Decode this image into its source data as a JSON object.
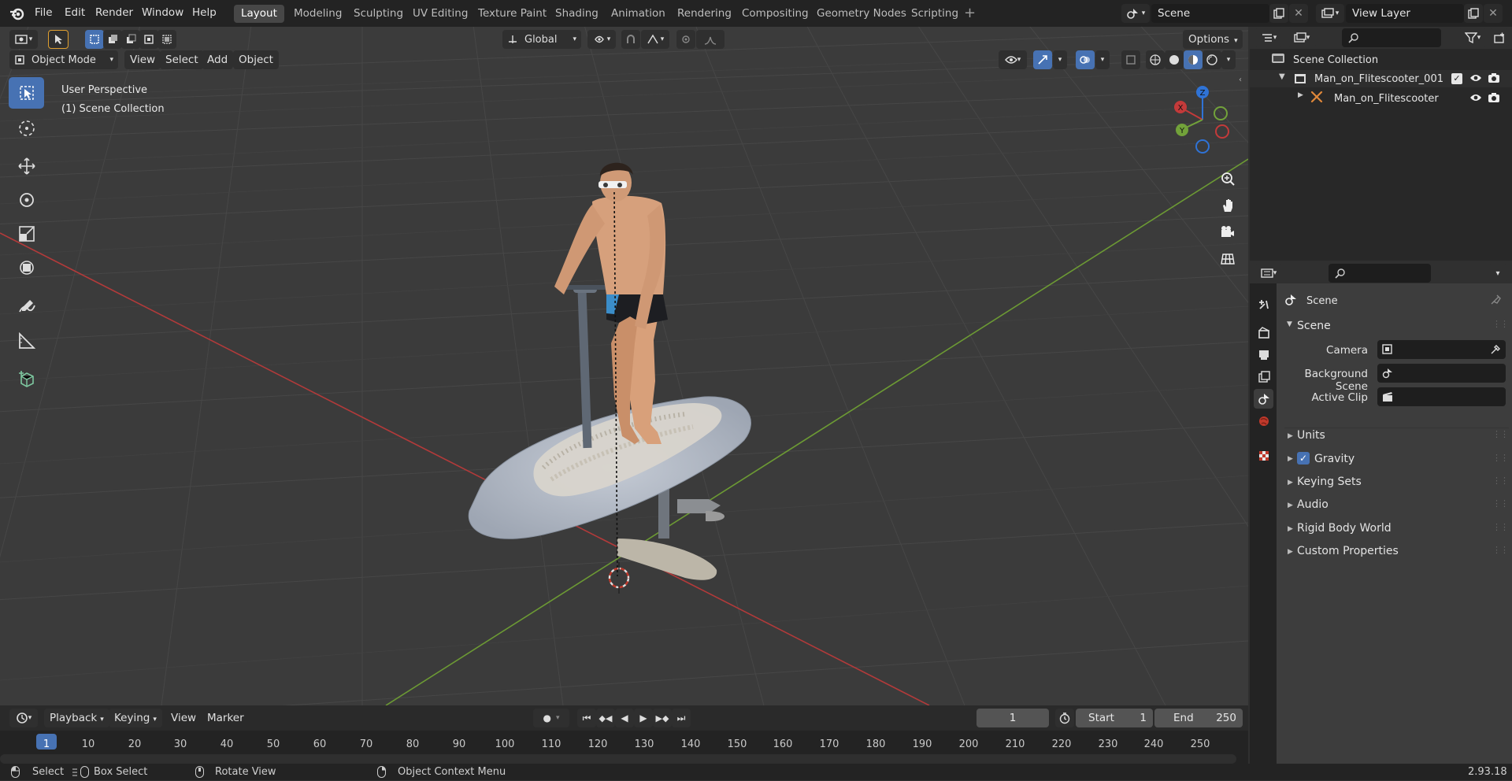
{
  "topbar": {
    "menus": [
      "File",
      "Edit",
      "Render",
      "Window",
      "Help"
    ],
    "workspaces": [
      "Layout",
      "Modeling",
      "Sculpting",
      "UV Editing",
      "Texture Paint",
      "Shading",
      "Animation",
      "Rendering",
      "Compositing",
      "Geometry Nodes",
      "Scripting"
    ],
    "active_workspace": "Layout",
    "scene_name": "Scene",
    "view_layer": "View Layer"
  },
  "viewport": {
    "orientation": "Global",
    "options_label": "Options",
    "mode": "Object Mode",
    "menus": [
      "View",
      "Select",
      "Add",
      "Object"
    ],
    "overlay_title": "User Perspective",
    "overlay_collection": "(1) Scene Collection",
    "gizmo_axes": {
      "x": "X",
      "y": "Y",
      "z": "Z"
    }
  },
  "outliner": {
    "root": "Scene Collection",
    "items": [
      {
        "label": "Man_on_Flitescooter_001"
      },
      {
        "label": "Man_on_Flitescooter"
      }
    ]
  },
  "properties": {
    "context": "Scene",
    "panel_title": "Scene",
    "camera_label": "Camera",
    "background_label": "Background Scene",
    "clip_label": "Active Clip",
    "subpanels": [
      "Units",
      "Gravity",
      "Keying Sets",
      "Audio",
      "Rigid Body World",
      "Custom Properties"
    ],
    "gravity_checked": true
  },
  "timeline": {
    "menus": [
      "Playback",
      "Keying",
      "View",
      "Marker"
    ],
    "current_frame": "1",
    "start_label": "Start",
    "start_value": "1",
    "end_label": "End",
    "end_value": "250",
    "ticks": [
      "1",
      "10",
      "20",
      "30",
      "40",
      "50",
      "60",
      "70",
      "80",
      "90",
      "100",
      "110",
      "120",
      "130",
      "140",
      "150",
      "160",
      "170",
      "180",
      "190",
      "200",
      "210",
      "220",
      "230",
      "240",
      "250"
    ]
  },
  "statusbar": {
    "select": "Select",
    "box_select": "Box Select",
    "rotate_view": "Rotate View",
    "context_menu": "Object Context Menu",
    "version": "2.93.18"
  },
  "colors": {
    "accent": "#4772b3",
    "x_axis": "#c33a3a",
    "y_axis": "#72a23a",
    "z_axis": "#2f73d6"
  }
}
